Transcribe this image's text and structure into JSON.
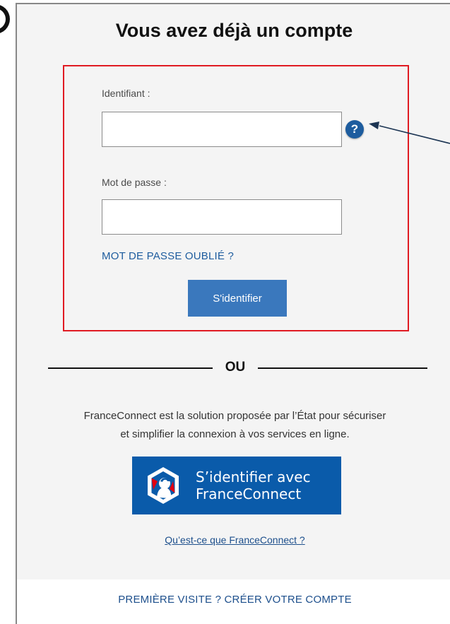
{
  "login": {
    "title": "Vous avez déjà un compte",
    "identifier_label": "Identifiant :",
    "identifier_value": "",
    "help_icon_glyph": "?",
    "password_label": "Mot de passe :",
    "password_value": "",
    "forgot_password": "MOT DE PASSE OUBLIÉ ?",
    "submit_label": "S'identifier"
  },
  "divider": {
    "label": "OU"
  },
  "franceconnect": {
    "description_line1": "FranceConnect est la solution proposée par l’État pour sécuriser",
    "description_line2": "et simplifier la connexion à vos services en ligne.",
    "button_line1": "S’identifier avec",
    "button_line2": "FranceConnect",
    "info_link": "Qu’est-ce que FranceConnect ?"
  },
  "footer": {
    "create_account": "PREMIÈRE VISITE ? CRÉER VOTRE COMPTE"
  },
  "colors": {
    "highlight_border": "#e01a22",
    "primary_blue": "#3a78bd",
    "franceconnect_blue": "#0a5baa",
    "link_blue": "#1d5c9e",
    "panel_background": "#f4f4f4"
  },
  "icons": {
    "help": "help-icon",
    "franceconnect_logo": "franceconnect-logo-icon",
    "annotation_arrow": "arrow-icon"
  }
}
